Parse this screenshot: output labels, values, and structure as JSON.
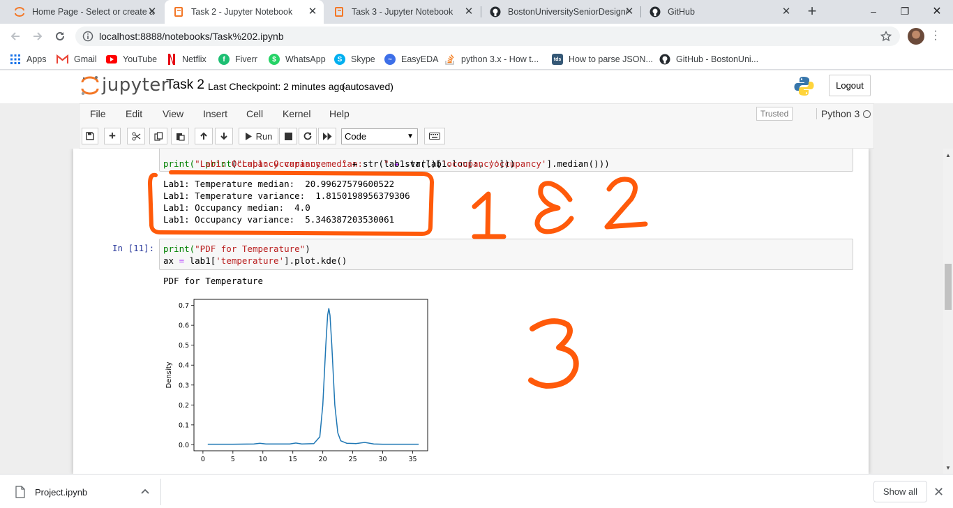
{
  "browser": {
    "tabs": [
      {
        "title": "Home Page - Select or create a",
        "icon": "jupyter-home-icon",
        "active": false
      },
      {
        "title": "Task 2 - Jupyter Notebook",
        "icon": "jupyter-notebook-icon",
        "active": true
      },
      {
        "title": "Task 3 - Jupyter Notebook",
        "icon": "jupyter-notebook-icon",
        "active": false
      },
      {
        "title": "BostonUniversitySeniorDesign/",
        "icon": "github-icon",
        "active": false
      },
      {
        "title": "GitHub",
        "icon": "github-icon",
        "active": false
      }
    ],
    "new_tab": "+",
    "window_controls": {
      "minimize": "–",
      "restore": "❐",
      "close": "✕"
    },
    "url": "localhost:8888/notebooks/Task%202.ipynb",
    "bookmarks": [
      {
        "label": "Apps",
        "icon": "apps-grid-icon",
        "color": "#1a73e8"
      },
      {
        "label": "Gmail",
        "icon": "gmail-icon",
        "color": "#ea4335"
      },
      {
        "label": "YouTube",
        "icon": "youtube-icon",
        "color": "#ff0000"
      },
      {
        "label": "Netflix",
        "icon": "netflix-icon",
        "color": "#e50914"
      },
      {
        "label": "Fiverr",
        "icon": "fiverr-icon",
        "color": "#1dbf73"
      },
      {
        "label": "WhatsApp",
        "icon": "whatsapp-icon",
        "color": "#25d366"
      },
      {
        "label": "Skype",
        "icon": "skype-icon",
        "color": "#00aff0"
      },
      {
        "label": "EasyEDA",
        "icon": "easyeda-icon",
        "color": "#3d6fe8"
      },
      {
        "label": "python 3.x - How t...",
        "icon": "stackoverflow-icon",
        "color": "#f48024"
      },
      {
        "label": "How to parse JSON...",
        "icon": "tds-icon",
        "color": "#355876"
      },
      {
        "label": "GitHub - BostonUni...",
        "icon": "github-icon",
        "color": "#24292e"
      }
    ]
  },
  "jupyter": {
    "logo_text": "jupyter",
    "notebook_title": "Task 2",
    "checkpoint": "Last Checkpoint: 2 minutes ago",
    "autosave": "(autosaved)",
    "logout": "Logout",
    "menu": [
      "File",
      "Edit",
      "View",
      "Insert",
      "Cell",
      "Kernel",
      "Help"
    ],
    "trusted": "Trusted",
    "kernel": "Python 3",
    "run_label": "Run",
    "cell_type": "Code"
  },
  "cells": {
    "prev_code_line1": "print(\"Lab1: Occupancy median:    \" + str(lab1.loc[:, 'occupancy'].median()))",
    "prev_code_line2_a": "print(",
    "prev_code_line2_str": "\"Lab1: Occupancy variance:  \"",
    "prev_code_line2_b": " + str(lab1.var()[",
    "prev_code_line2_key": "'occupancy'",
    "prev_code_line2_c": "]))",
    "output_lines": [
      "Lab1: Temperature median:  20.99627579600522",
      "Lab1: Temperature variance:  1.8150198956379306",
      "Lab1: Occupancy median:  4.0",
      "Lab1: Occupancy variance:  5.346387203530061"
    ],
    "cell11_prompt": "In [11]:",
    "cell11_line1_a": "print(",
    "cell11_line1_str": "\"PDF for Temperature\"",
    "cell11_line1_b": ")",
    "cell11_line2_a": "ax ",
    "cell11_line2_eq": "=",
    "cell11_line2_b": " lab1[",
    "cell11_line2_key": "'temperature'",
    "cell11_line2_c": "].plot.kde()",
    "cell11_output": "PDF for Temperature"
  },
  "annotations": {
    "label_1_2": "1 & 2",
    "label_3": "3",
    "color": "#ff5a0a"
  },
  "chart_data": {
    "type": "line",
    "title": "",
    "xlabel": "",
    "ylabel": "Density",
    "xlim": [
      -1.5,
      37.5
    ],
    "ylim": [
      -0.03,
      0.73
    ],
    "xticks": [
      0,
      5,
      10,
      15,
      20,
      25,
      30,
      35
    ],
    "yticks": [
      0.0,
      0.1,
      0.2,
      0.3,
      0.4,
      0.5,
      0.6,
      0.7
    ],
    "ytick_labels": [
      "0.0",
      "0.1",
      "0.2",
      "0.3",
      "0.4",
      "0.5",
      "0.6",
      "0.7"
    ],
    "series": [
      {
        "color": "#1f77b4",
        "x": [
          0.8,
          5.0,
          8.5,
          9.5,
          10.5,
          14.5,
          15.5,
          16.5,
          18.5,
          19.5,
          20.0,
          20.5,
          20.8,
          21.0,
          21.2,
          21.5,
          22.0,
          22.5,
          23.0,
          24.0,
          25.5,
          27.0,
          28.5,
          30.0,
          36.0
        ],
        "y": [
          0.003,
          0.003,
          0.004,
          0.008,
          0.004,
          0.004,
          0.009,
          0.004,
          0.006,
          0.04,
          0.2,
          0.5,
          0.65,
          0.685,
          0.65,
          0.5,
          0.2,
          0.06,
          0.02,
          0.008,
          0.006,
          0.012,
          0.004,
          0.003,
          0.003
        ]
      }
    ]
  },
  "downloads": {
    "file": "Project.ipynb",
    "show_all": "Show all"
  }
}
